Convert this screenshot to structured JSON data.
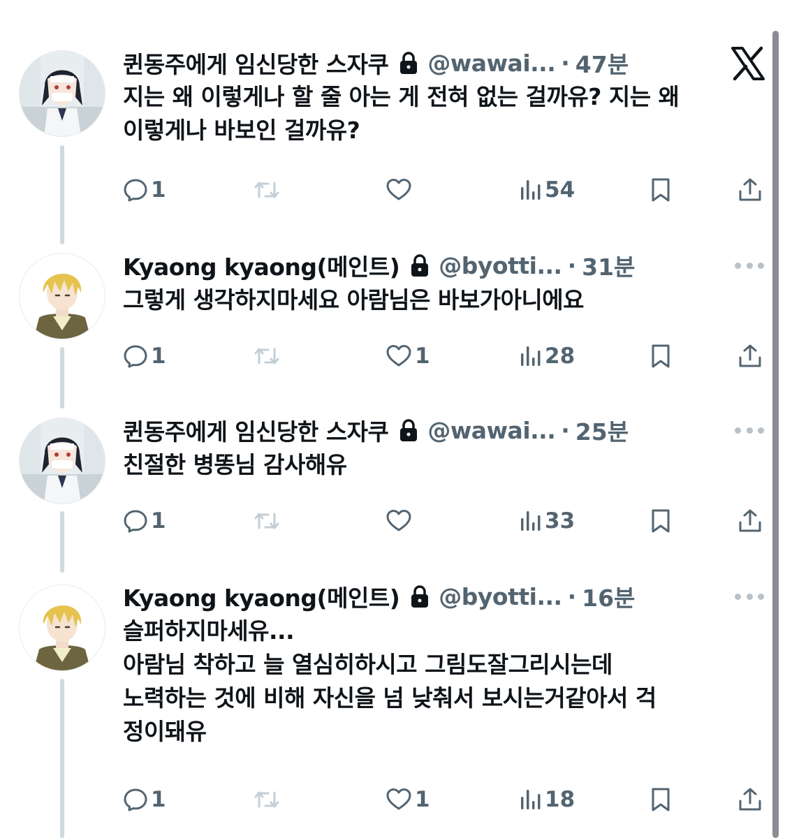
{
  "tweets": [
    {
      "name": "퀸동주에게 임신당한 스자쿠",
      "handle": "@wawai...",
      "time": "47분",
      "body": [
        "지는 왜 이렇게나 할 줄 아는 게 전혀 없는 걸까유? 지는 왜",
        "이렇게나 바보인 걸까유?"
      ],
      "replies": "1",
      "retweets": "",
      "likes": "",
      "views": "54",
      "avatar": "bandaged-girl-avatar"
    },
    {
      "name": "Kyaong kyaong(메인트)",
      "handle": "@byotti...",
      "time": "31분",
      "body": [
        "그렇게 생각하지마세요 아람님은 바보가아니에요"
      ],
      "replies": "1",
      "retweets": "",
      "likes": "1",
      "views": "28",
      "avatar": "blond-boy-avatar"
    },
    {
      "name": "퀸동주에게 임신당한 스자쿠",
      "handle": "@wawai...",
      "time": "25분",
      "body": [
        "친절한 병똥님 감사해유"
      ],
      "replies": "1",
      "retweets": "",
      "likes": "",
      "views": "33",
      "avatar": "bandaged-girl-avatar"
    },
    {
      "name": "Kyaong kyaong(메인트)",
      "handle": "@byotti...",
      "time": "16분",
      "body": [
        "슬퍼하지마세유...",
        "아람님 착하고 늘 열심히하시고 그림도잘그리시는데",
        "노력하는 것에 비해 자신을 넘 낮춰서 보시는거같아서 걱",
        "정이돼유"
      ],
      "replies": "1",
      "retweets": "",
      "likes": "1",
      "views": "18",
      "avatar": "blond-boy-avatar"
    }
  ],
  "separator": "·",
  "icons": {
    "brand": "x-logo-icon",
    "lock": "lock-icon",
    "reply": "reply-icon",
    "retweet": "retweet-icon",
    "like": "heart-icon",
    "views": "views-icon",
    "bookmark": "bookmark-icon",
    "share": "share-icon",
    "more": "more-icon"
  },
  "colors": {
    "text": "#0f1419",
    "secondary": "#536471",
    "thread_line": "#cfd9de",
    "disabled_icon": "#c4cfd6"
  }
}
